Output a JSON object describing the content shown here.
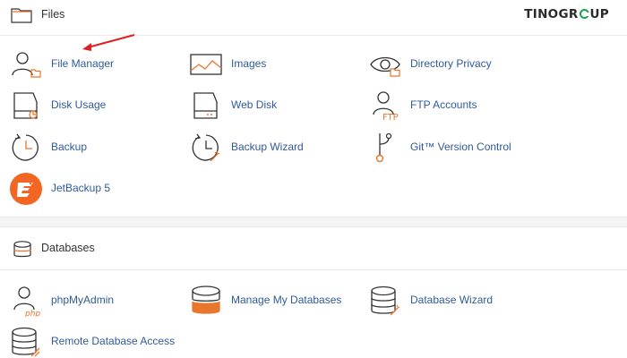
{
  "brand": {
    "text_left": "TINOGR",
    "text_right": "UP",
    "accent_color": "#1aa34a"
  },
  "files": {
    "title": "Files",
    "items": [
      {
        "label": "File Manager",
        "icon": "file-manager-icon"
      },
      {
        "label": "Images",
        "icon": "images-icon"
      },
      {
        "label": "Directory Privacy",
        "icon": "directory-privacy-icon"
      },
      {
        "label": "Disk Usage",
        "icon": "disk-usage-icon"
      },
      {
        "label": "Web Disk",
        "icon": "web-disk-icon"
      },
      {
        "label": "FTP Accounts",
        "icon": "ftp-accounts-icon"
      },
      {
        "label": "Backup",
        "icon": "backup-icon"
      },
      {
        "label": "Backup Wizard",
        "icon": "backup-wizard-icon"
      },
      {
        "label": "Git™ Version Control",
        "icon": "git-icon"
      },
      {
        "label": "JetBackup 5",
        "icon": "jetbackup-icon"
      }
    ]
  },
  "databases": {
    "title": "Databases",
    "items": [
      {
        "label": "phpMyAdmin",
        "icon": "phpmyadmin-icon",
        "icon_text": "php"
      },
      {
        "label": "Manage My Databases",
        "icon": "manage-databases-icon"
      },
      {
        "label": "Database Wizard",
        "icon": "database-wizard-icon"
      },
      {
        "label": "Remote Database Access",
        "icon": "remote-database-icon"
      }
    ]
  },
  "colors": {
    "link": "#2f5a9a",
    "icon_accent": "#e8762d",
    "icon_stroke": "#333333",
    "arrow": "#e02020"
  }
}
